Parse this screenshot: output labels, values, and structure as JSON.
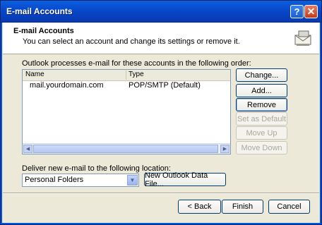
{
  "window": {
    "title": "E-mail Accounts",
    "help_glyph": "?",
    "close_glyph": "✕"
  },
  "header": {
    "title": "E-mail Accounts",
    "subtitle": "You can select an account and change its settings or remove it."
  },
  "accounts": {
    "lead_text": "Outlook processes e-mail for these accounts in the following order:",
    "columns": [
      "Name",
      "Type"
    ],
    "rows": [
      {
        "name": "mail.yourdomain.com",
        "type": "POP/SMTP (Default)"
      }
    ]
  },
  "side_buttons": {
    "change": "Change...",
    "add": "Add...",
    "remove": "Remove",
    "set_default": "Set as Default",
    "move_up": "Move Up",
    "move_down": "Move Down"
  },
  "delivery": {
    "label": "Deliver new e-mail to the following location:",
    "selected": "Personal Folders",
    "new_data_file": "New Outlook Data File..."
  },
  "footer": {
    "back": "< Back",
    "finish": "Finish",
    "cancel": "Cancel"
  }
}
